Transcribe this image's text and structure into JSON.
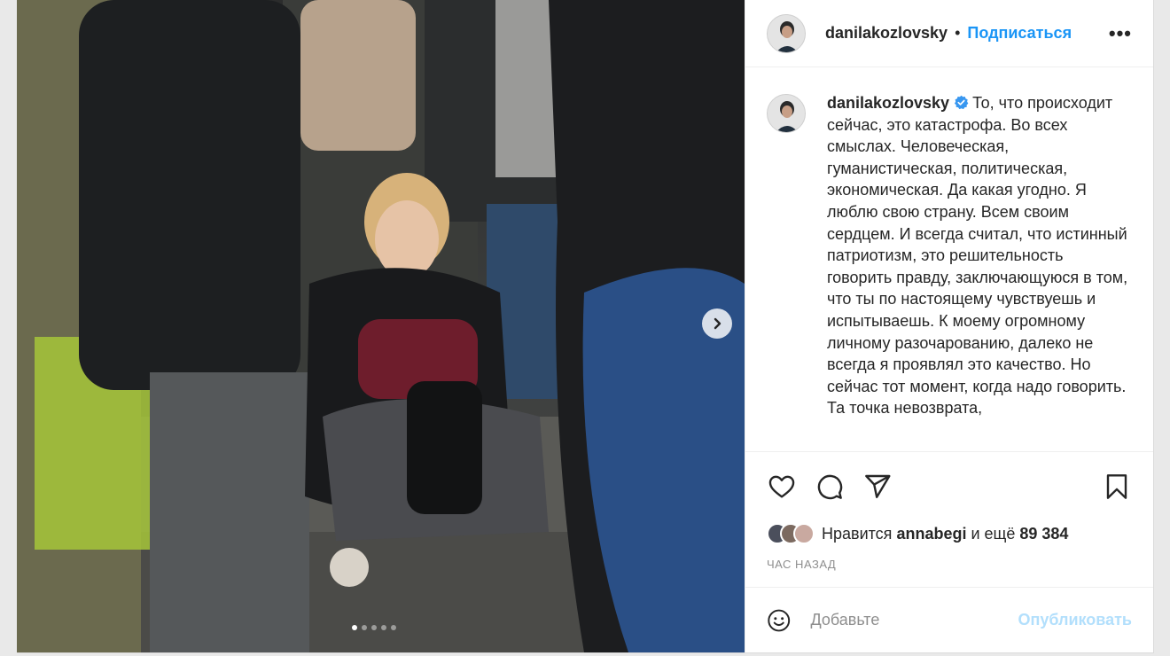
{
  "author": {
    "username": "danilakozlovsky",
    "separator": "•",
    "follow_label": "Подписаться",
    "more_label": "•••",
    "verified_icon": "verified-badge-icon"
  },
  "caption": {
    "text": "То, что происходит сейчас, это катастрофа. Во всех смыслах. Человеческая, гуманистическая, политическая, экономическая. Да какая угодно. Я люблю свою страну. Всем своим сердцем. И всегда считал, что истинный патриотизм, это решительность говорить правду, заключающуюся в том, что ты по настоящему чувствуешь и испытываешь. К моему огромному личному разочарованию, далеко не всегда я проявлял это качество. Но сейчас тот момент, когда надо говорить. Та точка невозврата,"
  },
  "carousel": {
    "dot_count": 5,
    "active_index": 0,
    "next_icon": "chevron-right-icon"
  },
  "actions": [
    "heart-icon",
    "comment-icon",
    "share-icon",
    "bookmark-icon"
  ],
  "likes": {
    "prefix": "Нравится",
    "user": "annabegi",
    "middle": "и ещё",
    "count": "89 384"
  },
  "timestamp": "ЧАС НАЗАД",
  "comment_box": {
    "placeholder": "Добавьте",
    "submit_label": "Опубликовать"
  },
  "colors": {
    "accent": "#1a95f6",
    "verified": "#3897f0",
    "submit_disabled": "#b2dffc"
  }
}
